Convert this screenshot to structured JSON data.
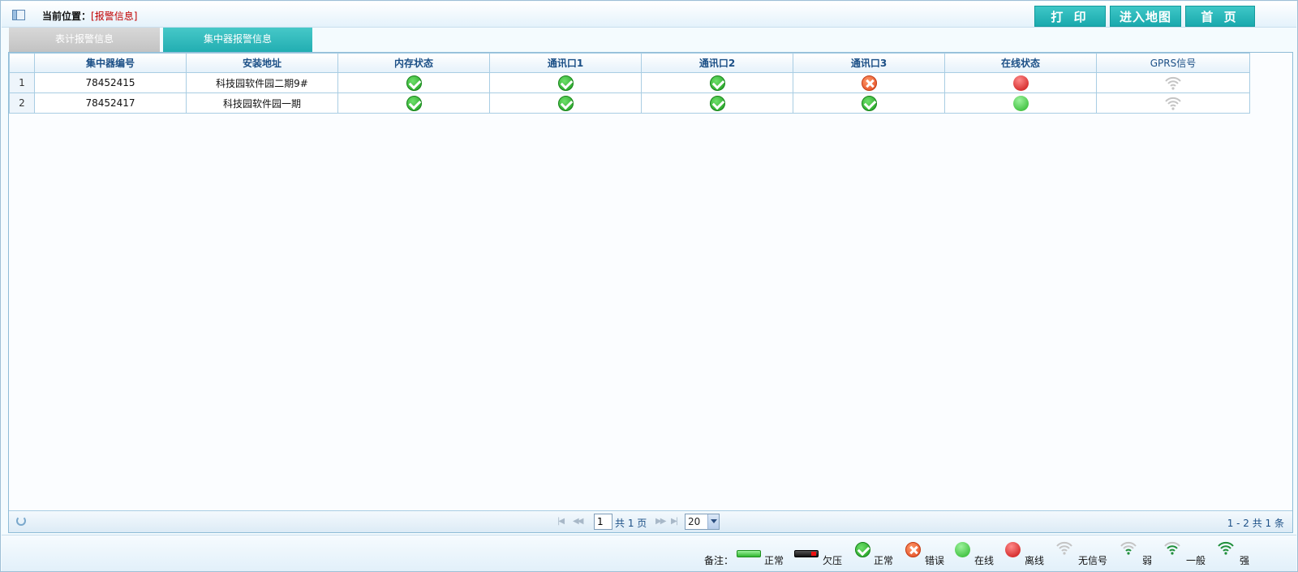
{
  "location": {
    "label": "当前位置：",
    "value": "[报警信息]"
  },
  "top_buttons": {
    "print": "打 印",
    "map": "进入地图",
    "home": "首 页"
  },
  "tabs": {
    "meter_alarm": "表计报警信息",
    "concentrator_alarm": "集中器报警信息",
    "active": "concentrator_alarm"
  },
  "table": {
    "headers": [
      "集中器编号",
      "安装地址",
      "内存状态",
      "通讯口1",
      "通讯口2",
      "通讯口3",
      "在线状态",
      "GPRS信号"
    ],
    "rows": [
      {
        "index": "1",
        "id": "78452415",
        "address": "科技园软件园二期9#",
        "memory": "ok",
        "port1": "ok",
        "port2": "ok",
        "port3": "error",
        "online": "offline",
        "gprs": "none"
      },
      {
        "index": "2",
        "id": "78452417",
        "address": "科技园软件园一期",
        "memory": "ok",
        "port1": "ok",
        "port2": "ok",
        "port3": "ok",
        "online": "online",
        "gprs": "none"
      }
    ]
  },
  "pager": {
    "page": "1",
    "total_pages": "共 1 页",
    "page_size": "20",
    "range": "1 - 2   共 1 条"
  },
  "legend": {
    "label": "备注：",
    "items": [
      "正常",
      "欠压",
      "正常",
      "错误",
      "在线",
      "离线",
      "无信号",
      "弱",
      "一般",
      "强"
    ]
  },
  "colors": {
    "accent": "#21adb1",
    "ok": "#1c9b1c",
    "error": "#e0451d",
    "offline": "#c81010",
    "online": "#28b428"
  }
}
